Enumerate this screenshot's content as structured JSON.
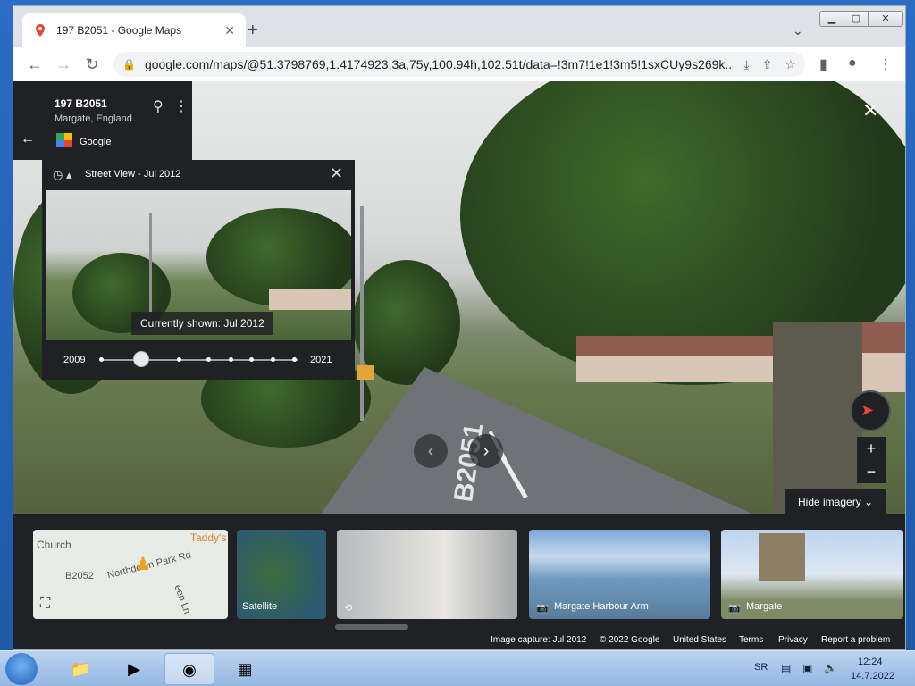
{
  "browser": {
    "tab_title": "197 B2051 - Google Maps",
    "tab_close": "✕",
    "new_tab": "+",
    "tab_search": "⌄",
    "url": "google.com/maps/@51.3798769,1.4174923,3a,75y,100.94h,102.51t/data=!3m7!1e1!3m5!1sxCUy9s269k...",
    "min_label": "▁",
    "max_label": "▢",
    "close_label": "✕"
  },
  "place_card": {
    "title": "197 B2051",
    "subtitle": "Margate, England",
    "source": "Google"
  },
  "street_view": {
    "title": "Street View - Jul 2012",
    "current_label": "Currently shown: Jul 2012",
    "year_start": "2009",
    "year_end": "2021",
    "slider_position": 0.21,
    "road_marking": "B2051"
  },
  "controls": {
    "hide_imagery": "Hide imagery ⌄",
    "zoom_in": "+",
    "zoom_out": "−"
  },
  "thumbnails": {
    "map_labels": [
      "Church",
      "B2052",
      "Northdown Park Rd",
      "Taddy's",
      "een Ln"
    ],
    "satellite": "Satellite",
    "harbour": "Margate Harbour Arm",
    "margate": "Margate"
  },
  "footer": {
    "capture": "Image capture: Jul 2012",
    "copyright": "© 2022 Google",
    "country": "United States",
    "terms": "Terms",
    "privacy": "Privacy",
    "report": "Report a problem"
  },
  "taskbar": {
    "language": "SR",
    "time": "12:24",
    "date": "14.7.2022"
  },
  "colors": {
    "map_ui_dark": "#202124",
    "chrome_frame": "#dee1e6",
    "compass_red": "#ea4335"
  }
}
